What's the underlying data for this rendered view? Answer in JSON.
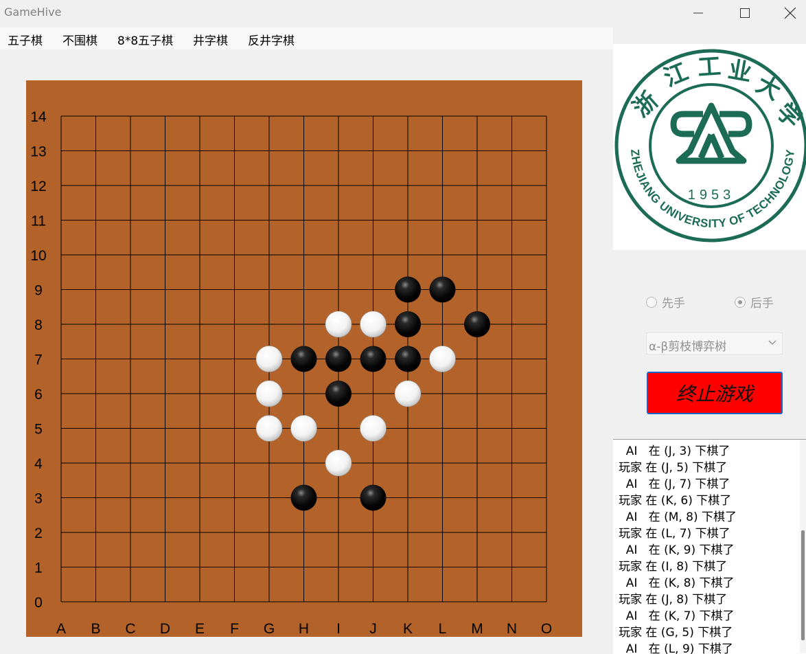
{
  "window": {
    "title": "GameHive"
  },
  "menu": [
    "五子棋",
    "不围棋",
    "8*8五子棋",
    "井字棋",
    "反井字棋"
  ],
  "board": {
    "columns": [
      "A",
      "B",
      "C",
      "D",
      "E",
      "F",
      "G",
      "H",
      "I",
      "J",
      "K",
      "L",
      "M",
      "N",
      "O"
    ],
    "rows": [
      "0",
      "1",
      "2",
      "3",
      "4",
      "5",
      "6",
      "7",
      "8",
      "9",
      "10",
      "11",
      "12",
      "13",
      "14"
    ],
    "board_color": "#b3632a",
    "stones": [
      {
        "col": "K",
        "row": 9,
        "color": "black"
      },
      {
        "col": "L",
        "row": 9,
        "color": "black"
      },
      {
        "col": "I",
        "row": 8,
        "color": "white"
      },
      {
        "col": "J",
        "row": 8,
        "color": "white"
      },
      {
        "col": "K",
        "row": 8,
        "color": "black"
      },
      {
        "col": "M",
        "row": 8,
        "color": "black"
      },
      {
        "col": "G",
        "row": 7,
        "color": "white"
      },
      {
        "col": "H",
        "row": 7,
        "color": "black"
      },
      {
        "col": "I",
        "row": 7,
        "color": "black"
      },
      {
        "col": "J",
        "row": 7,
        "color": "black"
      },
      {
        "col": "K",
        "row": 7,
        "color": "black"
      },
      {
        "col": "L",
        "row": 7,
        "color": "white"
      },
      {
        "col": "G",
        "row": 6,
        "color": "white"
      },
      {
        "col": "I",
        "row": 6,
        "color": "black"
      },
      {
        "col": "K",
        "row": 6,
        "color": "white"
      },
      {
        "col": "G",
        "row": 5,
        "color": "white"
      },
      {
        "col": "H",
        "row": 5,
        "color": "white"
      },
      {
        "col": "J",
        "row": 5,
        "color": "white"
      },
      {
        "col": "I",
        "row": 4,
        "color": "white"
      },
      {
        "col": "H",
        "row": 3,
        "color": "black"
      },
      {
        "col": "J",
        "row": 3,
        "color": "black"
      }
    ]
  },
  "logo": {
    "chinese": "浙江工业大学",
    "english": "ZHEJIANG UNIVERSITY OF TECHNOLOGY",
    "year": "1953",
    "color": "#1c6b55"
  },
  "turn_options": {
    "first": "先手",
    "second": "后手",
    "selected": "second"
  },
  "algorithm": {
    "selected": "α-β剪枝博弈树"
  },
  "stop_button": {
    "label": "终止游戏",
    "color": "#ff0000"
  },
  "log": [
    "  AI   在 (J, 3) 下棋了",
    "玩家 在 (J, 5) 下棋了",
    "  AI   在 (J, 7) 下棋了",
    "玩家 在 (K, 6) 下棋了",
    "  AI   在 (M, 8) 下棋了",
    "玩家 在 (L, 7) 下棋了",
    "  AI   在 (K, 9) 下棋了",
    "玩家 在 (I, 8) 下棋了",
    "  AI   在 (K, 8) 下棋了",
    "玩家 在 (J, 8) 下棋了",
    "  AI   在 (K, 7) 下棋了",
    "玩家 在 (G, 5) 下棋了",
    "  AI   在 (L, 9) 下棋了"
  ]
}
